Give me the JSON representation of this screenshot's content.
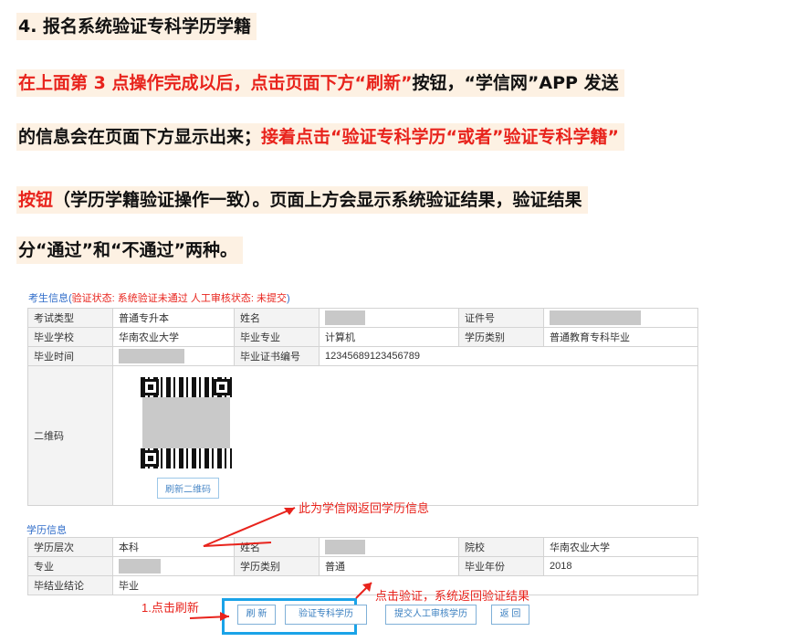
{
  "heading": "4. 报名系统验证专科学历学籍",
  "para": {
    "l2_red": "在上面第 3 点操作完成以后，点击页面下方",
    "l2_q": "“刷新”",
    "l2_black": "按钮，“学信网”APP 发送",
    "l3_black": "的信息会在页面下方显示出来；",
    "l3_red": "接着点击“验证专科学历“或者”验证专科学籍”",
    "l4_red": "按钮",
    "l4_black": "（学历学籍验证操作一致）。页面上方会显示系统验证结果，验证结果",
    "l5_black": "分“通过”和“不通过”两种。"
  },
  "figure": {
    "status_prefix": "考生信息(",
    "status_text": "验证状态:  系统验证未通过    人工审核状态:  未提交",
    "status_suffix": ")",
    "table1": {
      "r1": [
        "考试类型",
        "普通专升本",
        "姓名",
        "",
        "证件号",
        ""
      ],
      "r2": [
        "毕业学校",
        "华南农业大学",
        "毕业专业",
        "计算机",
        "学历类别",
        "普通教育专科毕业"
      ],
      "r3": [
        "毕业时间",
        "",
        "毕业证书编号",
        "12345689123456789"
      ],
      "qr_label": "二维码",
      "refresh_qr": "刷新二维码"
    },
    "edu_title": "学历信息",
    "table2": {
      "r1": [
        "学历层次",
        "本科",
        "姓名",
        "",
        "院校",
        "华南农业大学"
      ],
      "r2": [
        "专业",
        "",
        "学历类别",
        "普通",
        "毕业年份",
        "2018"
      ],
      "r3": [
        "毕结业结论",
        "毕业"
      ]
    },
    "buttons": {
      "refresh": "刷 新",
      "verify": "验证专科学历",
      "submit": "提交人工审核学历",
      "back": "返 回"
    },
    "annotations": {
      "a1": "此为学信网返回学历信息",
      "a2": "1.点击刷新",
      "a3": "点击验证，系统返回验证结果"
    },
    "colors": {
      "annotation": "#e8231c",
      "highlight_box": "#1aa3e8",
      "link": "#2f6cc9"
    }
  }
}
